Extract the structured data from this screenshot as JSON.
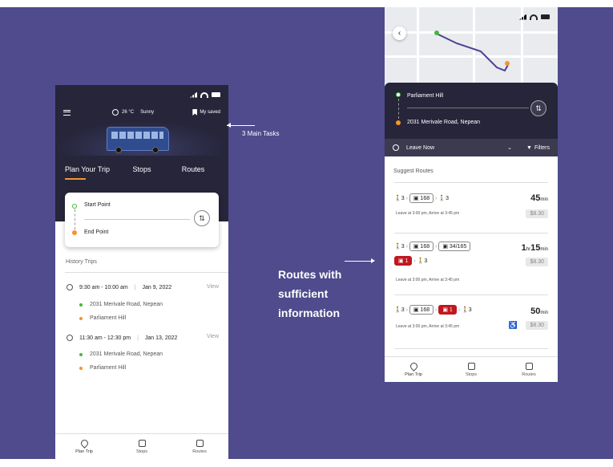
{
  "annotations": {
    "main_tasks": "3 Main Tasks",
    "routes_line1": "Routes with",
    "routes_line2": "sufficient",
    "routes_line3": "information"
  },
  "left_phone": {
    "weather_temp": "26 °C",
    "weather_text": "Sunny",
    "saved_label": "My saved",
    "tabs": [
      "Plan Your Trip",
      "Stops",
      "Routes"
    ],
    "start_point": "Start Point",
    "end_point": "End Point",
    "history_title": "History Trips",
    "history": [
      {
        "time": "9:30 am - 10:00 am",
        "date": "Jan 9, 2022",
        "view": "View",
        "from": "2031 Merivale Road, Nepean",
        "to": "Parliament Hill"
      },
      {
        "time": "11:30 am - 12:30 pm",
        "date": "Jan 13, 2022",
        "view": "View",
        "from": "2031 Merivale Road, Nepean",
        "to": "Parliament Hill"
      }
    ],
    "nav": [
      "Plan Trip",
      "Stops",
      "Routes"
    ]
  },
  "right_phone": {
    "origin": "Parliament Hill",
    "destination": "2031 Merivale Road, Nepean",
    "leave_now": "Leave Now",
    "filters": "Filters",
    "suggest_title": "Suggest Routes",
    "routes": [
      {
        "walk1": "3",
        "bus1": "168",
        "walk2": "3",
        "duration_num": "45",
        "duration_unit": "min",
        "price": "$8.30",
        "note": "Leave at 3:00 pm, Arrive at 3:45 pm"
      },
      {
        "walk1": "3",
        "bus1": "168",
        "bus2": "34/165",
        "train": "1",
        "walk2": "3",
        "duration_h": "1",
        "duration_h_unit": "hr",
        "duration_num": "15",
        "duration_unit": "min",
        "price": "$8.30",
        "note": "Leave at 3:00 pm, Arrive at 3:45 pm"
      },
      {
        "walk1": "3",
        "bus1": "168",
        "train": "1",
        "walk2": "3",
        "duration_num": "50",
        "duration_unit": "min",
        "price": "$8.30",
        "note": "Leave at 3:00 pm, Arrive at 3:45 pm"
      }
    ],
    "nav": [
      "Plan Trip",
      "Stops",
      "Routes"
    ]
  },
  "colors": {
    "background": "#4f4b8c",
    "dark": "#26253a",
    "accent": "#f5942d",
    "green": "#46b83a",
    "red": "#c0171f"
  }
}
